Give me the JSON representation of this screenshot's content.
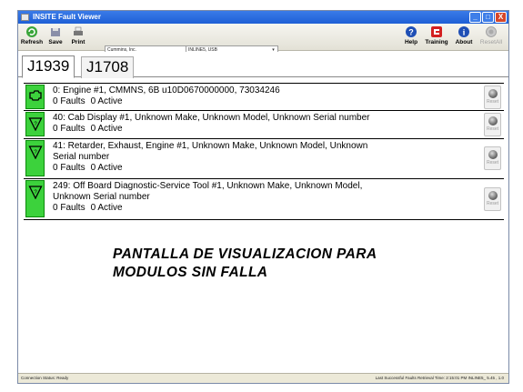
{
  "window": {
    "title": "INSITE Fault Viewer",
    "controls": [
      "_",
      "□",
      "X"
    ]
  },
  "toolbar": {
    "refresh_label": "Refresh",
    "save_label": "Save",
    "print_label": "Print",
    "help_label": "Help",
    "training_label": "Training",
    "about_label": "About",
    "resetall_label": "ResetAll",
    "manufacturer_select": "Cummins, Inc.",
    "adapter_select": "INLINE5, USB"
  },
  "tabs": [
    {
      "label": "J1939",
      "active": true
    },
    {
      "label": "J1708",
      "active": false
    }
  ],
  "modules": [
    {
      "status_icon": "engine-icon",
      "line1": "0: Engine #1, CMMNS, 6B u10D0670000000, 73034246",
      "line2": "",
      "faults": "0 Faults",
      "active": "0 Active",
      "reset": "Reset"
    },
    {
      "status_icon": "warning-triangle-icon",
      "line1": "40: Cab Display #1, Unknown Make, Unknown Model, Unknown Serial number",
      "line2": "",
      "faults": "0 Faults",
      "active": "0 Active",
      "reset": "Reset"
    },
    {
      "status_icon": "warning-triangle-icon",
      "line1": "41: Retarder, Exhaust, Engine #1, Unknown Make, Unknown Model, Unknown",
      "line2": "Serial number",
      "faults": "0 Faults",
      "active": "0 Active",
      "reset": "Reset"
    },
    {
      "status_icon": "warning-triangle-icon",
      "line1": "249: Off Board Diagnostic-Service Tool #1, Unknown Make, Unknown Model,",
      "line2": "Unknown Serial number",
      "faults": "0 Faults",
      "active": "0 Active",
      "reset": "Reset"
    }
  ],
  "annotation": {
    "line1": "PANTALLA DE VISUALIZACION PARA",
    "line2": "MODULOS SIN FALLA"
  },
  "statusbar": {
    "connection": "Connection Status:  Ready",
    "last_retrieval": "Last Successful Faults Retrieval Time:  2:15:01 PM     INLINE5_ 5.45 , 1.0"
  },
  "colors": {
    "status_green": "#3cd23c",
    "titlebar_blue": "#1e5fd6"
  }
}
